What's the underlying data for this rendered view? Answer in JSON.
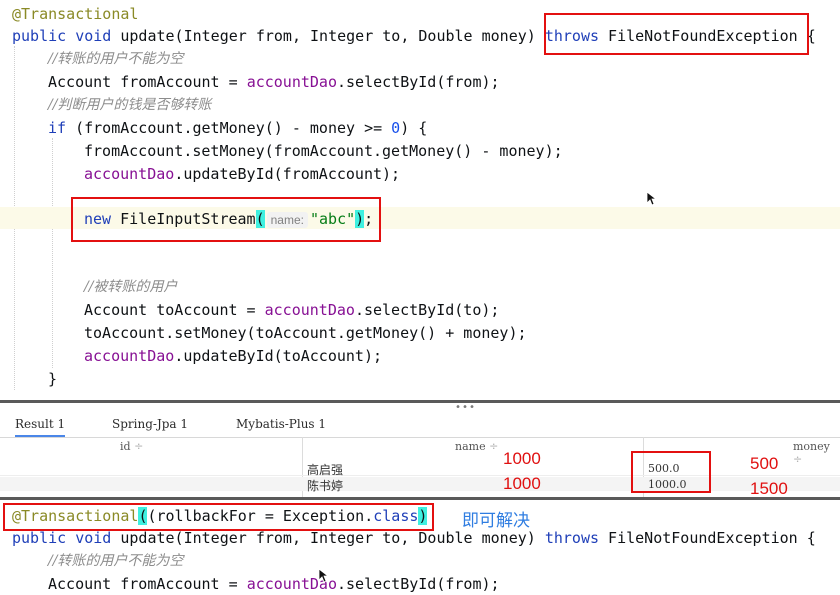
{
  "code_top": {
    "annotation": "@Transactional",
    "sig_public": "public",
    "sig_void": "void",
    "sig_rest": "update(Integer from, Integer to, Double money)",
    "sig_throws": "throws",
    "sig_exception": "FileNotFoundException",
    "sig_brace": "{",
    "comment1": "//转账的用户不能为空",
    "l3_a": "Account fromAccount = ",
    "l3_field": "accountDao",
    "l3_b": ".selectById(from);",
    "comment2": "//判断用户的钱是否够转账",
    "l5_if": "if",
    "l5_a": " (fromAccount.getMoney() - money >= ",
    "l5_num": "0",
    "l5_b": ") {",
    "l6": "fromAccount.setMoney(fromAccount.getMoney() - money);",
    "l7_field": "accountDao",
    "l7_b": ".updateById(fromAccount);",
    "l9_new": "new",
    "l9_cls": " FileInputStream",
    "l9_open": "(",
    "l9_hint": "name:",
    "l9_str": "\"abc\"",
    "l9_close": ")",
    "l9_semi": ";",
    "comment3": "//被转账的用户",
    "l11": "Account toAccount = ",
    "l11_field": "accountDao",
    "l11_b": ".selectById(to);",
    "l12": "toAccount.setMoney(toAccount.getMoney() + money);",
    "l13_field": "accountDao",
    "l13_b": ".updateById(toAccount);",
    "l14": "}"
  },
  "results": {
    "tabs": [
      "Result 1",
      "Spring-Jpa 1",
      "Mybatis-Plus 1"
    ],
    "columns": [
      "id",
      "name",
      "money"
    ],
    "rows": [
      {
        "name": "高启强",
        "money": "500.0"
      },
      {
        "name": "陈书婷",
        "money": "1000.0"
      }
    ],
    "annotations": {
      "before_1": "1000",
      "before_2": "1000",
      "after_1": "500",
      "after_2": "1500"
    }
  },
  "code_bottom": {
    "annotation": "@Transactional",
    "ann_args": "(rollbackFor = Exception.",
    "ann_class": "class",
    "ann_close": ")",
    "solution_note": "即可解决",
    "sig_public": "public",
    "sig_void": "void",
    "sig_rest": "update(Integer from, Integer to, Double money)",
    "sig_throws": "throws",
    "sig_exception": "FileNotFoundException {",
    "comment1": "//转账的用户不能为空",
    "l3_a": "Account fromAccount = ",
    "l3_field": "accountDao",
    "l3_b": ".selectById(from);"
  },
  "colors": {
    "keyword": "#1f3fb8",
    "annotation": "#8a8a26",
    "field": "#871094",
    "comment": "#8c8c8c",
    "highlight_box": "#e31010",
    "note_blue": "#2f7de1"
  }
}
